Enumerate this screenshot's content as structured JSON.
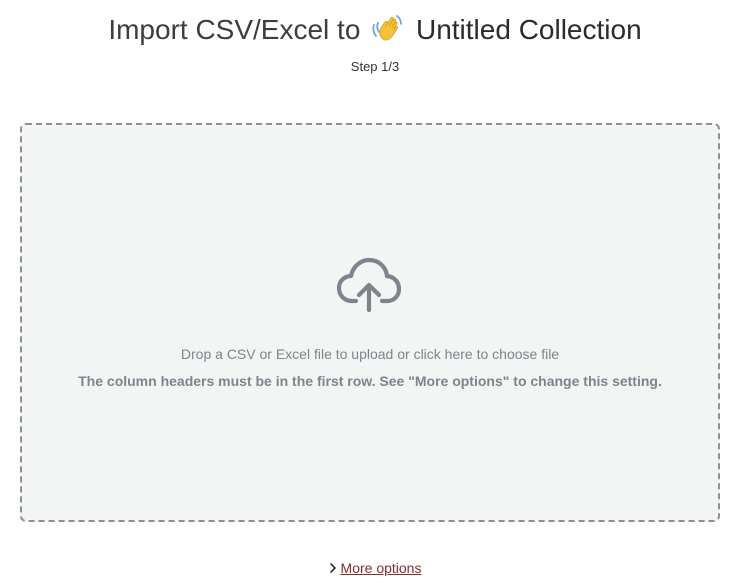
{
  "header": {
    "title_prefix": "Import CSV/Excel to",
    "collection_icon": "waving-hand-emoji",
    "collection_name": "Untitled Collection",
    "step": "Step 1/3"
  },
  "dropzone": {
    "icon": "cloud-upload-icon",
    "primary_text": "Drop a CSV or Excel file to upload or click here to choose file",
    "hint_text": "The column headers must be in the first row. See \"More options\" to change this setting."
  },
  "footer": {
    "more_options_icon": "chevron-right-icon",
    "more_options_label": "More options"
  },
  "colors": {
    "link": "#8b2a2a",
    "dropzone_bg": "#f3f5f5",
    "dropzone_border": "#8a8f98",
    "muted_text": "#7e848c"
  }
}
